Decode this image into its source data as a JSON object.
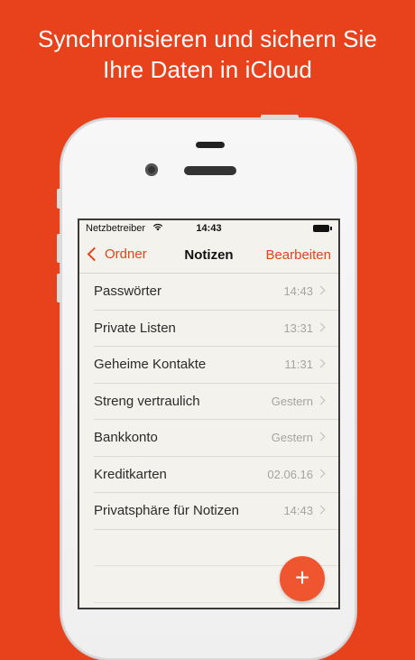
{
  "headline": {
    "line1": "Synchronisieren und sichern Sie",
    "line2": "Ihre Daten in iCloud"
  },
  "statusbar": {
    "carrier": "Netzbetreiber",
    "time": "14:43"
  },
  "navbar": {
    "back_label": "Ordner",
    "title": "Notizen",
    "edit_label": "Bearbeiten"
  },
  "notes": [
    {
      "title": "Passwörter",
      "meta": "14:43"
    },
    {
      "title": "Private Listen",
      "meta": "13:31"
    },
    {
      "title": "Geheime Kontakte",
      "meta": "11:31"
    },
    {
      "title": "Streng vertraulich",
      "meta": "Gestern"
    },
    {
      "title": "Bankkonto",
      "meta": "Gestern"
    },
    {
      "title": "Kreditkarten",
      "meta": "02.06.16"
    },
    {
      "title": "Privatsphäre für Notizen",
      "meta": "14:43"
    }
  ],
  "fab": {
    "label": "+"
  },
  "colors": {
    "background": "#e8421c",
    "accent": "#e4431c",
    "fab": "#ef5630"
  }
}
